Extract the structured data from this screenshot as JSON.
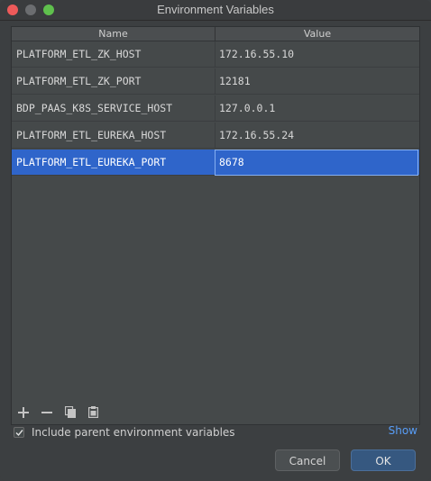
{
  "window": {
    "title": "Environment Variables"
  },
  "table": {
    "headers": {
      "name": "Name",
      "value": "Value"
    },
    "rows": [
      {
        "name": "PLATFORM_ETL_ZK_HOST",
        "value": "172.16.55.10",
        "selected": false
      },
      {
        "name": "PLATFORM_ETL_ZK_PORT",
        "value": "12181",
        "selected": false
      },
      {
        "name": "BDP_PAAS_K8S_SERVICE_HOST",
        "value": "127.0.0.1",
        "selected": false
      },
      {
        "name": "PLATFORM_ETL_EUREKA_HOST",
        "value": "172.16.55.24",
        "selected": false
      },
      {
        "name": "PLATFORM_ETL_EUREKA_PORT",
        "value": "8678",
        "selected": true
      }
    ]
  },
  "toolbar": {
    "add_icon": "plus-icon",
    "remove_icon": "minus-icon",
    "copy_icon": "copy-icon",
    "paste_icon": "paste-icon"
  },
  "options": {
    "include_parent_label": "Include parent environment variables",
    "include_parent_checked": true,
    "show_link": "Show"
  },
  "buttons": {
    "cancel": "Cancel",
    "ok": "OK"
  },
  "colors": {
    "selection": "#2f65ca",
    "link": "#589df6"
  }
}
